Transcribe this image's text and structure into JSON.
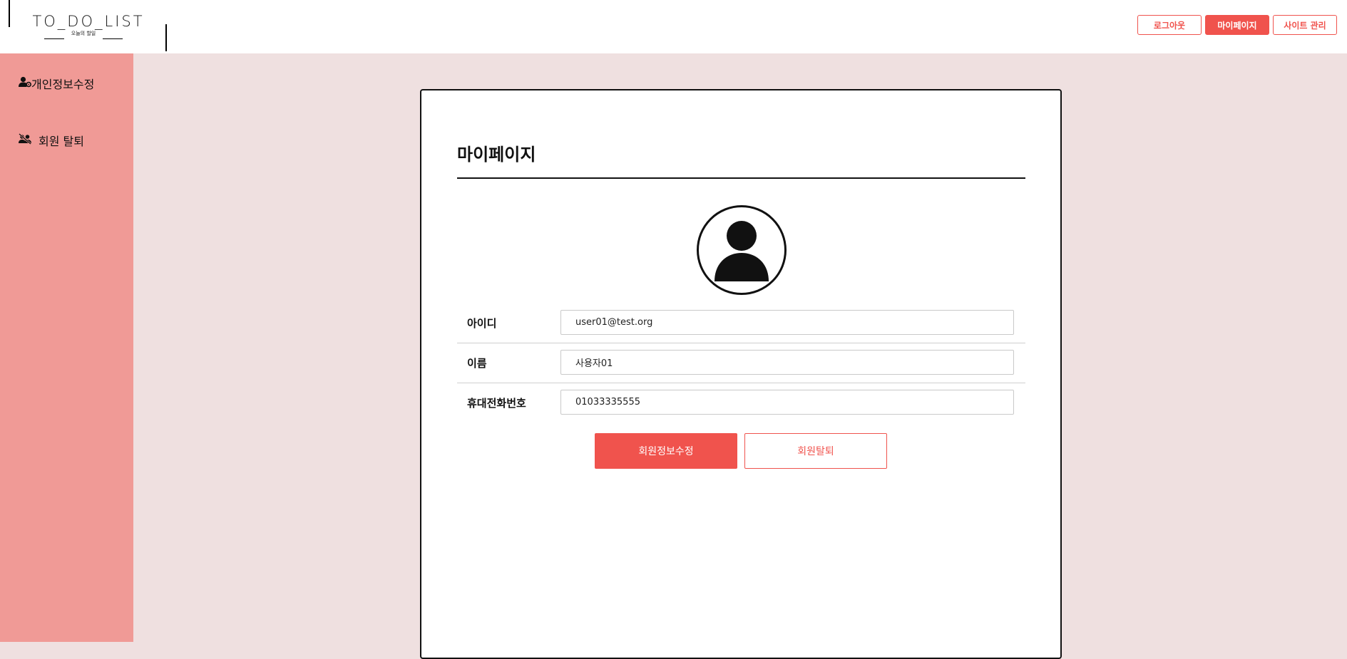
{
  "header": {
    "logo_text": "TO_DO_LIST",
    "logo_subtext": "오늘의 할일",
    "buttons": {
      "logout": "로그아웃",
      "mypage": "마이페이지",
      "admin": "사이트 관리"
    }
  },
  "sidebar": {
    "items": [
      {
        "label": "개인정보수정",
        "icon": "user-gear-icon"
      },
      {
        "label": "회원 탈퇴",
        "icon": "users-slash-icon"
      }
    ]
  },
  "main": {
    "title": "마이페이지",
    "avatar_icon": "user-avatar-icon",
    "fields": [
      {
        "label": "아이디",
        "value": "user01@test.org"
      },
      {
        "label": "이름",
        "value": "사용자01"
      },
      {
        "label": "휴대전화번호",
        "value": "01033335555"
      }
    ],
    "actions": {
      "edit": "회원정보수정",
      "withdraw": "회원탈퇴"
    }
  },
  "colors": {
    "accent": "#f0534d",
    "sidebar_bg": "#f09a96",
    "page_bg": "#efe0e0"
  }
}
